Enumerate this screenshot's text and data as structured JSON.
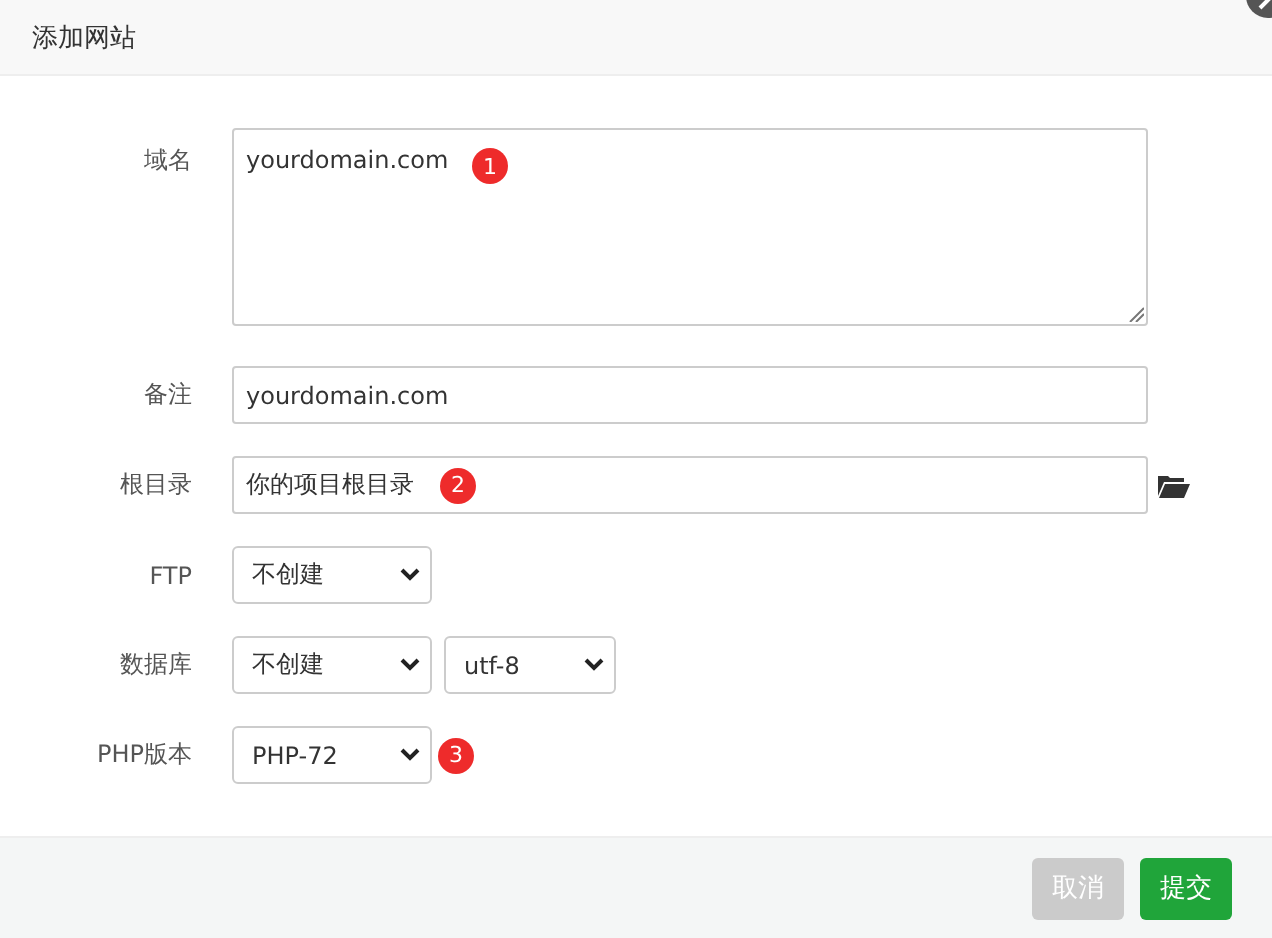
{
  "dialog": {
    "title": "添加网站"
  },
  "fields": [
    {
      "kind": "textarea",
      "label": "域名",
      "value": "yourdomain.com",
      "badge": "1"
    },
    {
      "kind": "input",
      "label": "备注",
      "value": "yourdomain.com"
    },
    {
      "kind": "path",
      "label": "根目录",
      "value": "你的项目根目录",
      "badge": "2"
    },
    {
      "kind": "select",
      "label": "FTP",
      "selects": [
        "不创建"
      ]
    },
    {
      "kind": "select",
      "label": "数据库",
      "selects": [
        "不创建",
        "utf-8"
      ]
    },
    {
      "kind": "select",
      "label": "PHP版本",
      "selects": [
        "PHP-72"
      ],
      "badge": "3"
    }
  ],
  "buttons": [
    {
      "kind": "secondary",
      "label": "取消"
    },
    {
      "kind": "primary",
      "label": "提交"
    }
  ]
}
